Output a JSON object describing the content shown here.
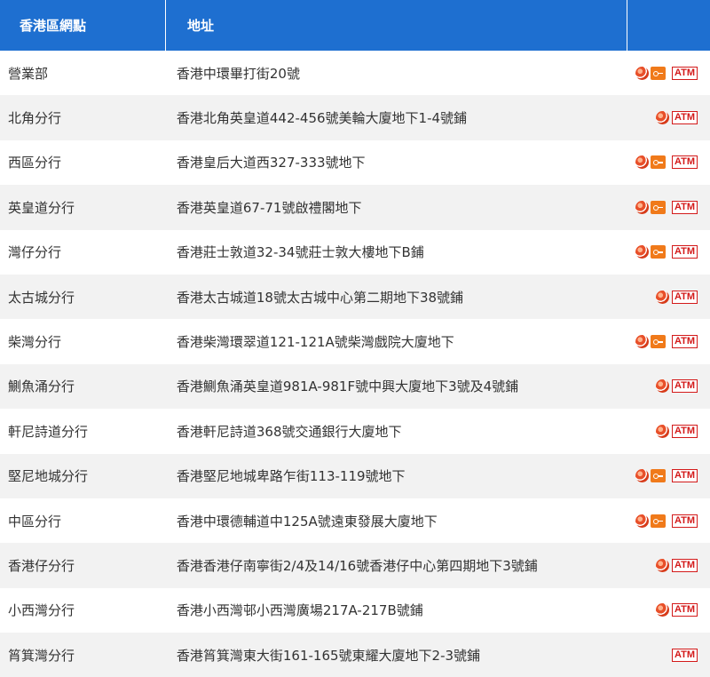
{
  "header": {
    "district": "香港區網點",
    "address": "地址",
    "services": ""
  },
  "rows": [
    {
      "name": "營業部",
      "address": "香港中環畢打街20號",
      "services": [
        "cheque-icon",
        "key-icon",
        "atm"
      ]
    },
    {
      "name": "北角分行",
      "address": "香港北角英皇道442-456號美輪大廈地下1-4號鋪",
      "services": [
        "cheque-icon",
        "atm"
      ]
    },
    {
      "name": "西區分行",
      "address": "香港皇后大道西327-333號地下",
      "services": [
        "cheque-icon",
        "key-icon",
        "atm"
      ]
    },
    {
      "name": "英皇道分行",
      "address": "香港英皇道67-71號啟禮閣地下",
      "services": [
        "cheque-icon",
        "key-icon",
        "atm"
      ]
    },
    {
      "name": "灣仔分行",
      "address": "香港莊士敦道32-34號莊士敦大樓地下B鋪",
      "services": [
        "cheque-icon",
        "key-icon",
        "atm"
      ]
    },
    {
      "name": "太古城分行",
      "address": "香港太古城道18號太古城中心第二期地下38號鋪",
      "services": [
        "cheque-icon",
        "atm"
      ]
    },
    {
      "name": "柴灣分行",
      "address": "香港柴灣環翠道121-121A號柴灣戲院大廈地下",
      "services": [
        "cheque-icon",
        "key-icon",
        "atm"
      ]
    },
    {
      "name": "鰂魚涌分行",
      "address": "香港鰂魚涌英皇道981A-981F號中興大廈地下3號及4號鋪",
      "services": [
        "cheque-icon",
        "atm"
      ]
    },
    {
      "name": "軒尼詩道分行",
      "address": "香港軒尼詩道368號交通銀行大廈地下",
      "services": [
        "cheque-icon",
        "atm"
      ]
    },
    {
      "name": "堅尼地城分行",
      "address": "香港堅尼地城卑路乍街113-119號地下",
      "services": [
        "cheque-icon",
        "key-icon",
        "atm"
      ]
    },
    {
      "name": "中區分行",
      "address": "香港中環德輔道中125A號遠東發展大廈地下",
      "services": [
        "cheque-icon",
        "key-icon",
        "atm"
      ]
    },
    {
      "name": "香港仔分行",
      "address": "香港香港仔南寧街2/4及14/16號香港仔中心第四期地下3號鋪",
      "services": [
        "cheque-icon",
        "atm"
      ]
    },
    {
      "name": "小西灣分行",
      "address": "香港小西灣邨小西灣廣場217A-217B號鋪",
      "services": [
        "cheque-icon",
        "atm"
      ]
    },
    {
      "name": "筲箕灣分行",
      "address": "香港筲箕灣東大街161-165號東耀大廈地下2-3號鋪",
      "services": [
        "atm"
      ]
    }
  ],
  "atm_label": "ATM",
  "colors": {
    "header_bg": "#1e6fd0",
    "atm_red": "#d31a1a",
    "key_orange": "#f07a1a"
  }
}
